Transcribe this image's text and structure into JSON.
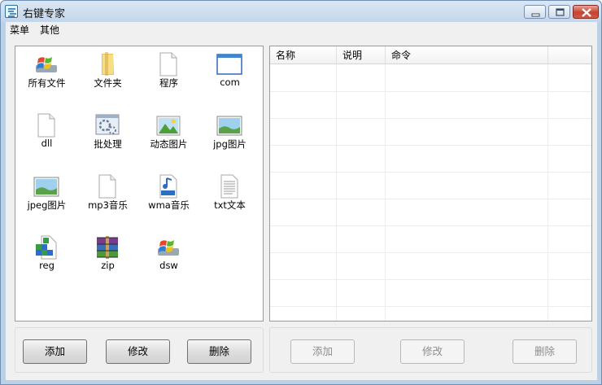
{
  "window": {
    "title": "右键专家"
  },
  "menu": [
    "菜单",
    "其他"
  ],
  "file_types": [
    {
      "label": "所有文件",
      "icon": "windows-flag-icon"
    },
    {
      "label": "文件夹",
      "icon": "folder-icon"
    },
    {
      "label": "程序",
      "icon": "blank-file-icon"
    },
    {
      "label": "com",
      "icon": "window-app-icon"
    },
    {
      "label": "dll",
      "icon": "blank-file-icon"
    },
    {
      "label": "批处理",
      "icon": "batch-gear-icon"
    },
    {
      "label": "动态图片",
      "icon": "image-file-icon"
    },
    {
      "label": "jpg图片",
      "icon": "picture-icon"
    },
    {
      "label": "jpeg图片",
      "icon": "picture-icon"
    },
    {
      "label": "mp3音乐",
      "icon": "blank-file-icon"
    },
    {
      "label": "wma音乐",
      "icon": "wma-music-icon"
    },
    {
      "label": "txt文本",
      "icon": "text-file-icon"
    },
    {
      "label": "reg",
      "icon": "registry-icon"
    },
    {
      "label": "zip",
      "icon": "winrar-icon"
    },
    {
      "label": "dsw",
      "icon": "windows-flag-icon"
    }
  ],
  "command_list": {
    "columns": [
      "名称",
      "说明",
      "命令"
    ],
    "rows": []
  },
  "left_buttons": {
    "add": "添加",
    "edit": "修改",
    "delete": "删除"
  },
  "right_buttons": {
    "add": "添加",
    "edit": "修改",
    "delete": "删除",
    "disabled": true
  }
}
